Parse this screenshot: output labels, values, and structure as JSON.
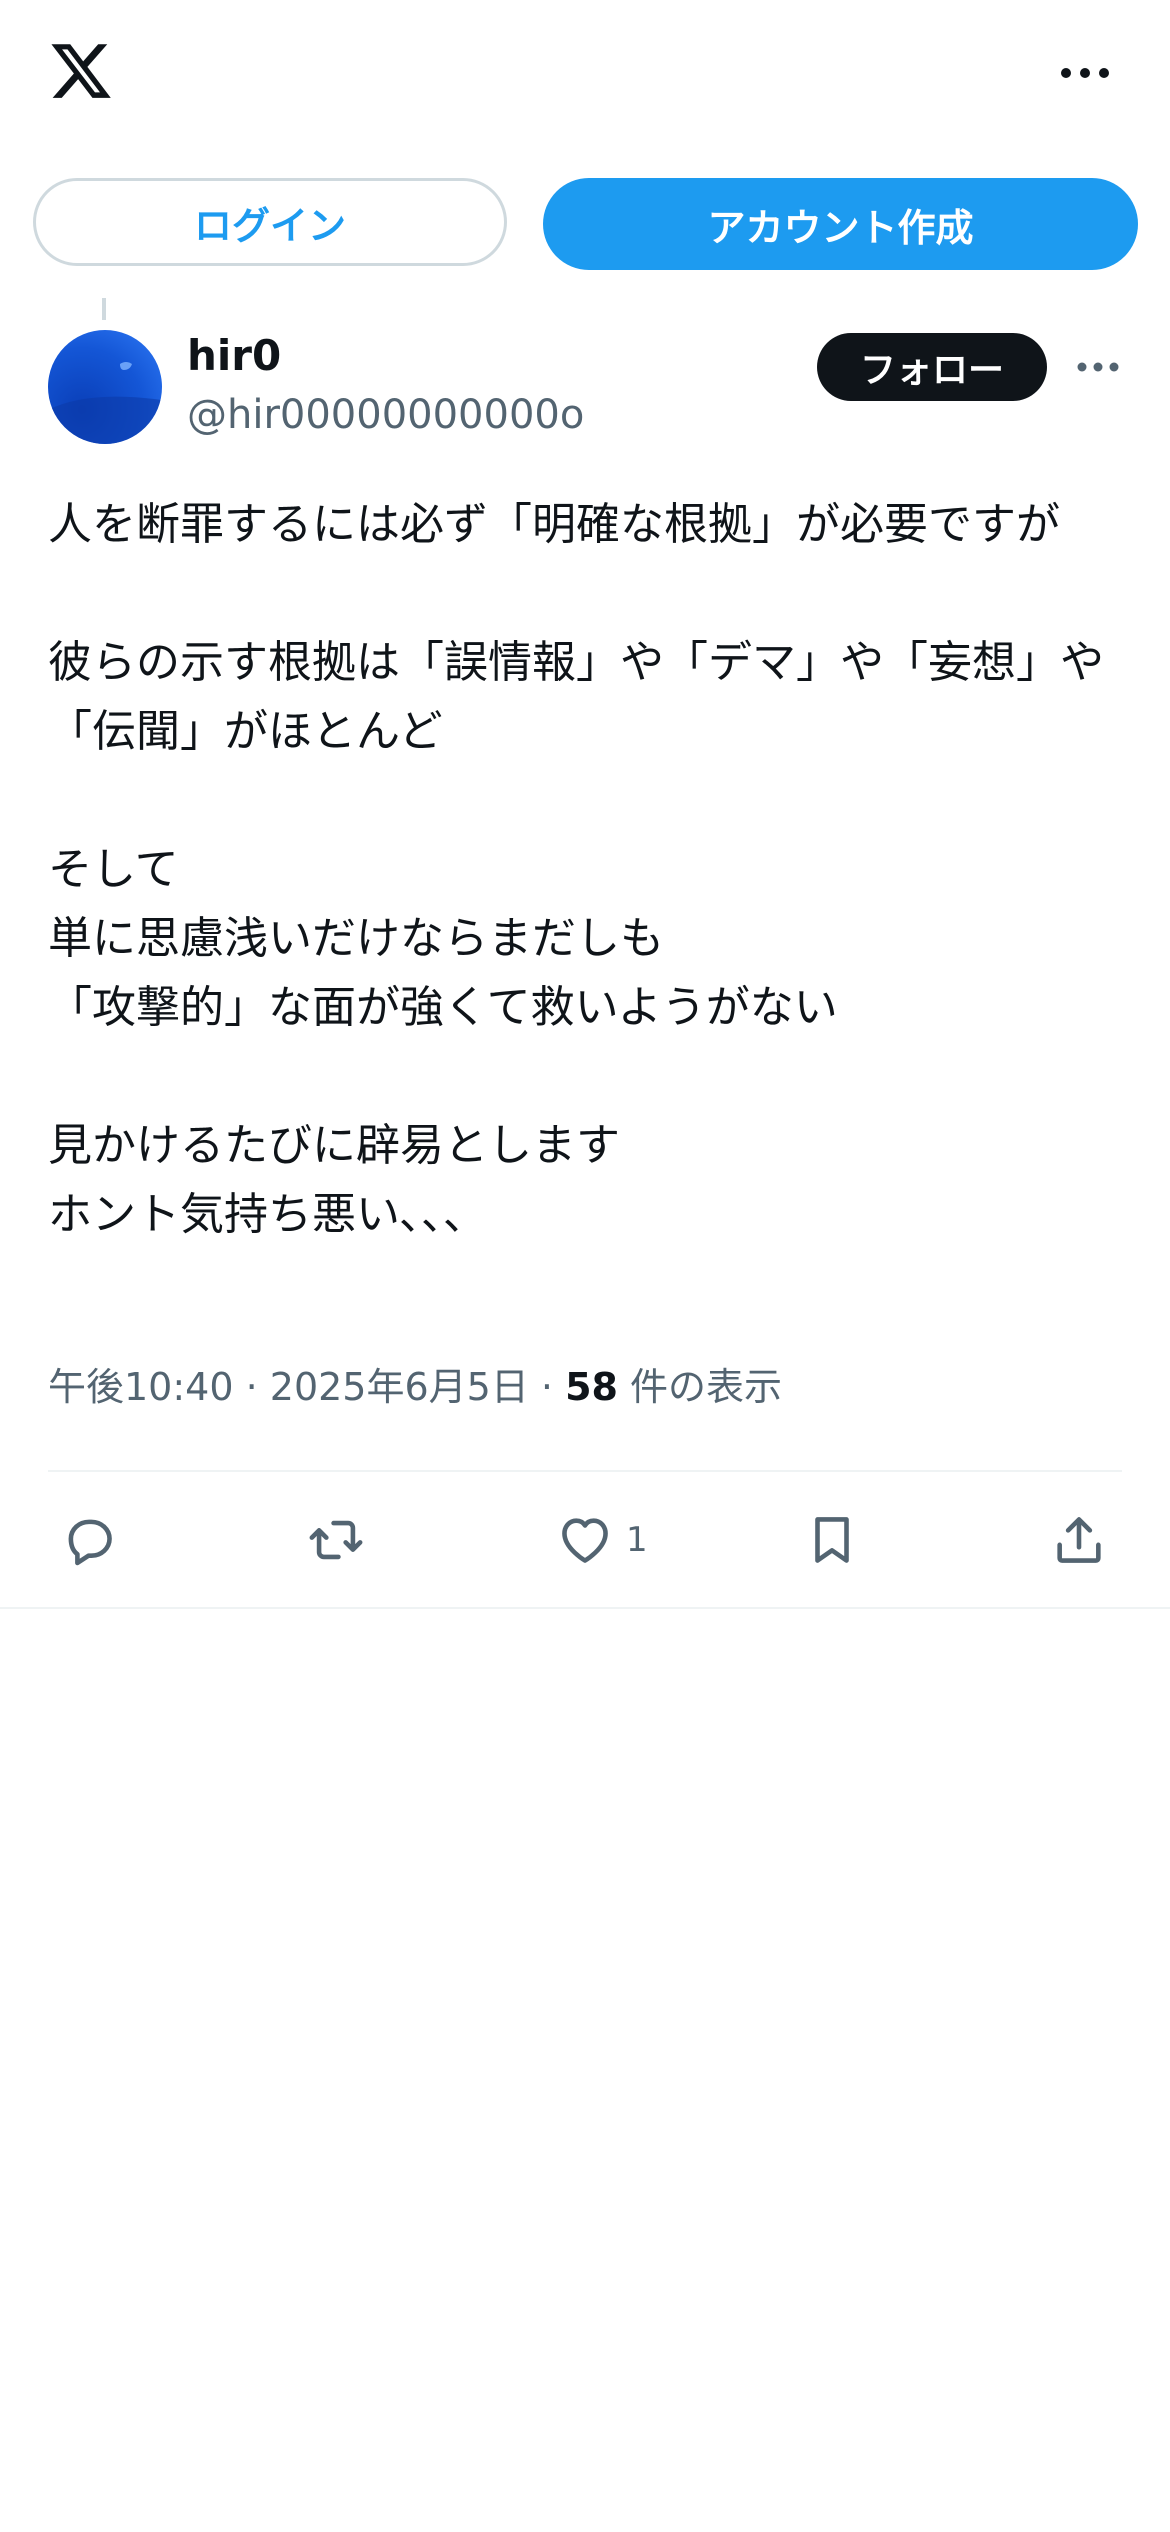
{
  "header": {
    "logo_icon": "x-logo-icon",
    "more_icon": "more-horizontal-icon"
  },
  "auth": {
    "login_label": "ログイン",
    "signup_label": "アカウント作成"
  },
  "post": {
    "author": {
      "display_name": "hir0",
      "handle": "@hir00000000000o"
    },
    "follow_label": "フォロー",
    "text": "人を断罪するには必ず「明確な根拠」が必要ですが\n\n彼らの示す根拠は「誤情報」や「デマ」や「妄想」や「伝聞」がほとんど\n\nそして\n単に思慮浅いだけならまだしも\n「攻撃的」な面が強くて救いようがない\n\n見かけるたびに辟易とします\nホント気持ち悪い､､､",
    "time": "午後10:40",
    "sep1": " · ",
    "date": "2025年6月5日",
    "sep2": " · ",
    "views_count": "58",
    "views_label": " 件の表示",
    "like_count": "1"
  },
  "actions": {
    "reply_icon": "reply-icon",
    "retweet_icon": "retweet-icon",
    "like_icon": "heart-icon",
    "bookmark_icon": "bookmark-icon",
    "share_icon": "share-icon"
  },
  "colors": {
    "accent": "#1d9bf0",
    "text": "#0f1419",
    "secondary": "#536471",
    "border": "#cfd9de"
  }
}
